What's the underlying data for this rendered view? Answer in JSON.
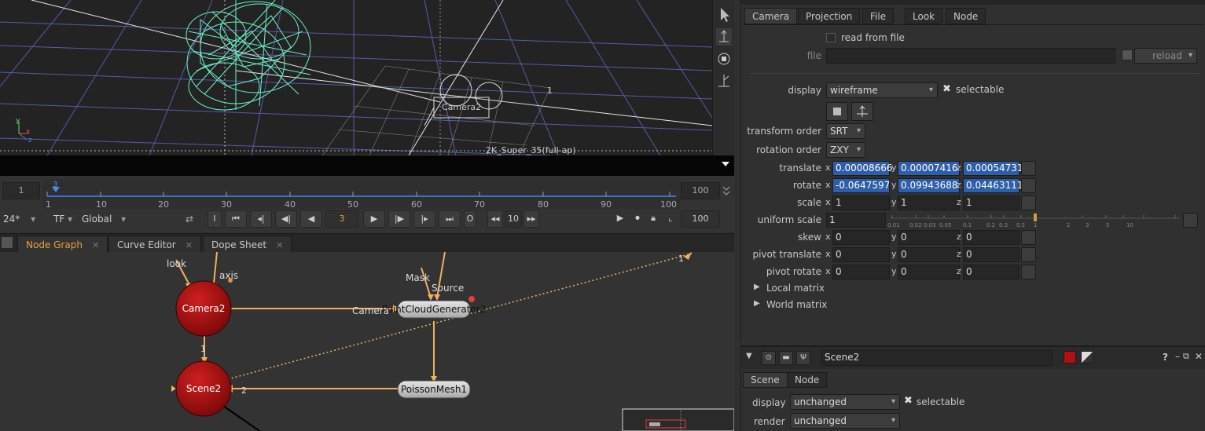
{
  "viewer": {
    "camera_label": "Camera2",
    "format_label": "2K_Super_35(full-ap)",
    "frame_marker": "1",
    "axis_y": "y",
    "axis_x": "x",
    "axis_z": "z",
    "colors": {
      "mesh": "#6ff0c8",
      "grid": "#6b6bd8",
      "background": "#232323"
    }
  },
  "timeline": {
    "start_frame": "1",
    "end_frame": "100",
    "current_frame": "3",
    "ticks": [
      "1",
      "10",
      "20",
      "30",
      "40",
      "50",
      "60",
      "70",
      "80",
      "90",
      "100"
    ],
    "fps": "24*",
    "tf": "TF",
    "mode": "Global",
    "in_label": "I",
    "out_label": "O",
    "step": "10",
    "out_frame": "100"
  },
  "node_graph_tabs": [
    {
      "label": "Node Graph",
      "close": "✕"
    },
    {
      "label": "Curve Editor",
      "close": "✕"
    },
    {
      "label": "Dope Sheet",
      "close": "✕"
    }
  ],
  "nodes": {
    "camera2": "Camera2",
    "scene2": "Scene2",
    "pointcloud": "PointCloudGenerator2",
    "poissonmesh": "PoissonMesh1",
    "input_look": "look",
    "input_axis": "axis",
    "input_mask": "Mask",
    "input_source": "Source",
    "input_camera": "Camera",
    "edge_label_1": "1",
    "edge_label_2": "2",
    "edge_label_top": "1",
    "colors": {
      "node_red": "#b01010",
      "pipe": "#f0b060",
      "selected_dot": "#e09050"
    }
  },
  "properties": {
    "tabs": [
      "Camera",
      "Projection",
      "File",
      "Look",
      "Node"
    ],
    "read_from_file": "read from file",
    "file_label": "file",
    "reload_label": "reload",
    "display_label": "display",
    "display_value": "wireframe",
    "selectable_label": "selectable",
    "transform_order_label": "transform order",
    "transform_order_value": "SRT",
    "rotation_order_label": "rotation order",
    "rotation_order_value": "ZXY",
    "translate_label": "translate",
    "translate": {
      "x": "0.00008666",
      "y": "0.00007416",
      "z": "0.00054731"
    },
    "rotate_label": "rotate",
    "rotate": {
      "x": "-0.0647597",
      "y": "0.09943688",
      "z": "0.04463111"
    },
    "scale_label": "scale",
    "scale": {
      "x": "1",
      "y": "1",
      "z": "1"
    },
    "uniform_scale_label": "uniform scale",
    "uniform_scale_value": "1",
    "uniform_scale_ticks": [
      "0.01",
      "0.02",
      "0.03",
      "0.05",
      "0.1",
      "0.2",
      "0.3",
      "0.5",
      "1",
      "2",
      "3",
      "5",
      "10"
    ],
    "skew_label": "skew",
    "skew": {
      "x": "0",
      "y": "0",
      "z": "0"
    },
    "pivot_translate_label": "pivot translate",
    "pivot_translate": {
      "x": "0",
      "y": "0",
      "z": "0"
    },
    "pivot_rotate_label": "pivot rotate",
    "pivot_rotate": {
      "x": "0",
      "y": "0",
      "z": "0"
    },
    "local_matrix_label": "Local matrix",
    "world_matrix_label": "World matrix",
    "axis_labels": {
      "x": "x",
      "y": "y",
      "z": "z"
    }
  },
  "scene_panel": {
    "name": "Scene2",
    "tabs": [
      "Scene",
      "Node"
    ],
    "display_label": "display",
    "display_value": "unchanged",
    "selectable_label": "selectable",
    "render_label": "render",
    "render_value": "unchanged"
  }
}
